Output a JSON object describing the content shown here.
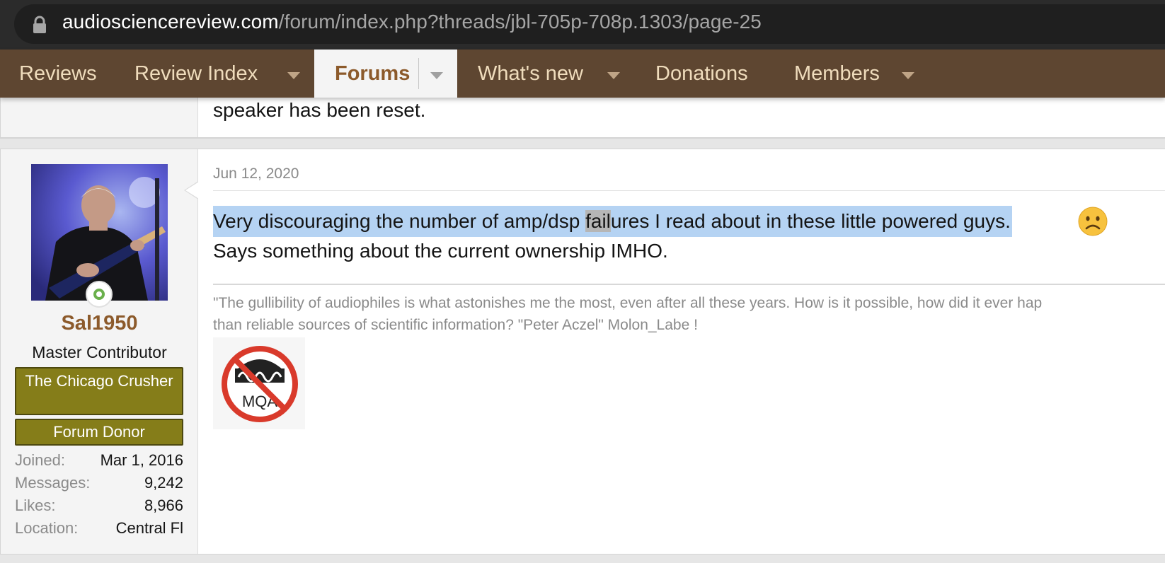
{
  "browser": {
    "url_domain": "audiosciencereview.com",
    "url_path": "/forum/index.php?threads/jbl-705p-708p.1303/page-25"
  },
  "nav": {
    "items": [
      {
        "label": "Reviews",
        "has_menu": false
      },
      {
        "label": "Review Index",
        "has_menu": true
      },
      {
        "label": "Forums",
        "has_menu": true,
        "active": true
      },
      {
        "label": "What's new",
        "has_menu": true
      },
      {
        "label": "Donations",
        "has_menu": false
      },
      {
        "label": "Members",
        "has_menu": true
      }
    ]
  },
  "previous_post": {
    "text_tail": "speaker has been reset."
  },
  "post": {
    "date": "Jun 12, 2020",
    "body": {
      "line1_before": "Very discouraging the number of amp/dsp ",
      "line1_highlight": "fail",
      "line1_after": "ures I read about in these little powered guys.",
      "emoji": "frowning-face-icon",
      "line2": "Says something about the current ownership IMHO."
    },
    "signature": {
      "line1": "\"The gullibility of audiophiles is what astonishes me the most, even after all these years. How is it possible, how did it ever hap",
      "line2": "than reliable sources of scientific information? \"Peter Aczel\" Molon_Labe !",
      "image_text": "MQA"
    }
  },
  "user": {
    "name": "Sal1950",
    "title": "Master Contributor",
    "banners": [
      "The Chicago Crusher",
      "Forum Donor"
    ],
    "stats": [
      {
        "label": "Joined:",
        "value": "Mar 1, 2016"
      },
      {
        "label": "Messages:",
        "value": "9,242"
      },
      {
        "label": "Likes:",
        "value": "8,966"
      },
      {
        "label": "Location:",
        "value": "Central Fl"
      }
    ]
  },
  "colors": {
    "nav_bg": "#5e4631",
    "accent": "#8c5a2b",
    "banner": "#857d19",
    "selection": "#b5d3f3"
  }
}
